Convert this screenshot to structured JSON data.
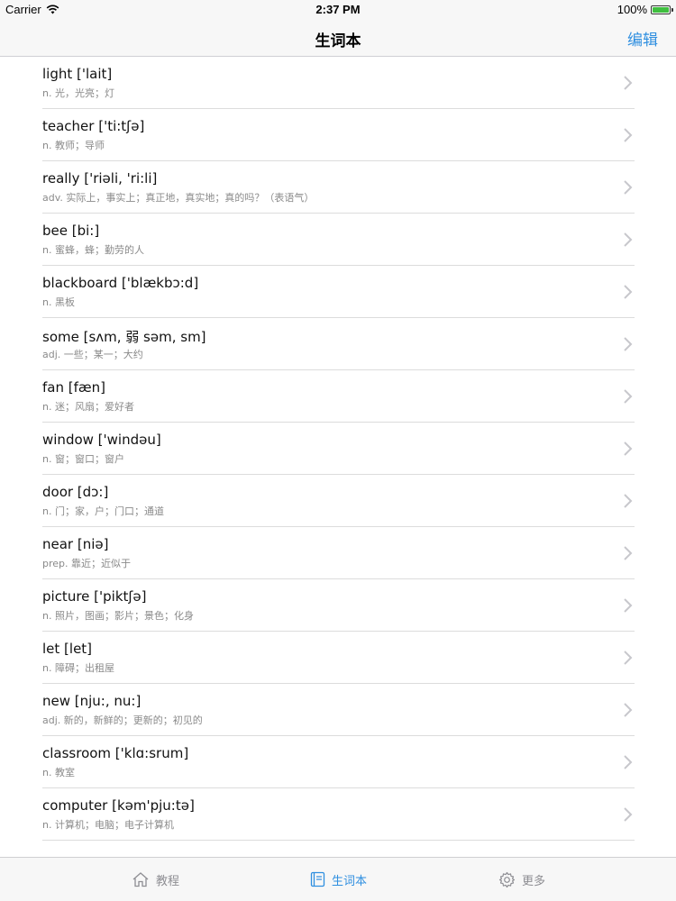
{
  "status_bar": {
    "carrier": "Carrier",
    "time": "2:37 PM",
    "battery": "100%"
  },
  "nav": {
    "title": "生词本",
    "edit_label": "编辑"
  },
  "words": [
    {
      "word": "light ['lait]",
      "def": "n. 光，光亮；灯"
    },
    {
      "word": "teacher ['ti:tʃə]",
      "def": "n. 教师；导师"
    },
    {
      "word": "really ['riəli, 'ri:li]",
      "def": "adv. 实际上，事实上；真正地，真实地；真的吗？（表语气）"
    },
    {
      "word": "bee [bi:]",
      "def": "n. 蜜蜂，蜂；勤劳的人"
    },
    {
      "word": "blackboard ['blækbɔ:d]",
      "def": "n. 黑板"
    },
    {
      "word": "some [sʌm, 弱 səm, sm]",
      "def": "adj. 一些；某一；大约"
    },
    {
      "word": "fan [fæn]",
      "def": "n. 迷；风扇；爱好者"
    },
    {
      "word": "window ['windəu]",
      "def": "n. 窗；窗口；窗户"
    },
    {
      "word": "door [dɔ:]",
      "def": "n. 门；家，户；门口；通道"
    },
    {
      "word": "near [niə]",
      "def": "prep. 靠近；近似于"
    },
    {
      "word": "picture ['piktʃə]",
      "def": "n. 照片，图画；影片；景色；化身"
    },
    {
      "word": "let [let]",
      "def": "n. 障碍；出租屋"
    },
    {
      "word": "new [nju:, nu:]",
      "def": "adj. 新的，新鲜的；更新的；初见的"
    },
    {
      "word": "classroom ['klɑ:srum]",
      "def": "n. 教室"
    },
    {
      "word": "computer [kəm'pju:tə]",
      "def": "n. 计算机；电脑；电子计算机"
    }
  ],
  "tabs": [
    {
      "label": "教程",
      "icon": "home-icon",
      "active": false
    },
    {
      "label": "生词本",
      "icon": "notebook-icon",
      "active": true
    },
    {
      "label": "更多",
      "icon": "gear-icon",
      "active": false
    }
  ],
  "colors": {
    "accent": "#2f8fe0",
    "inactive": "#8e8e93"
  }
}
